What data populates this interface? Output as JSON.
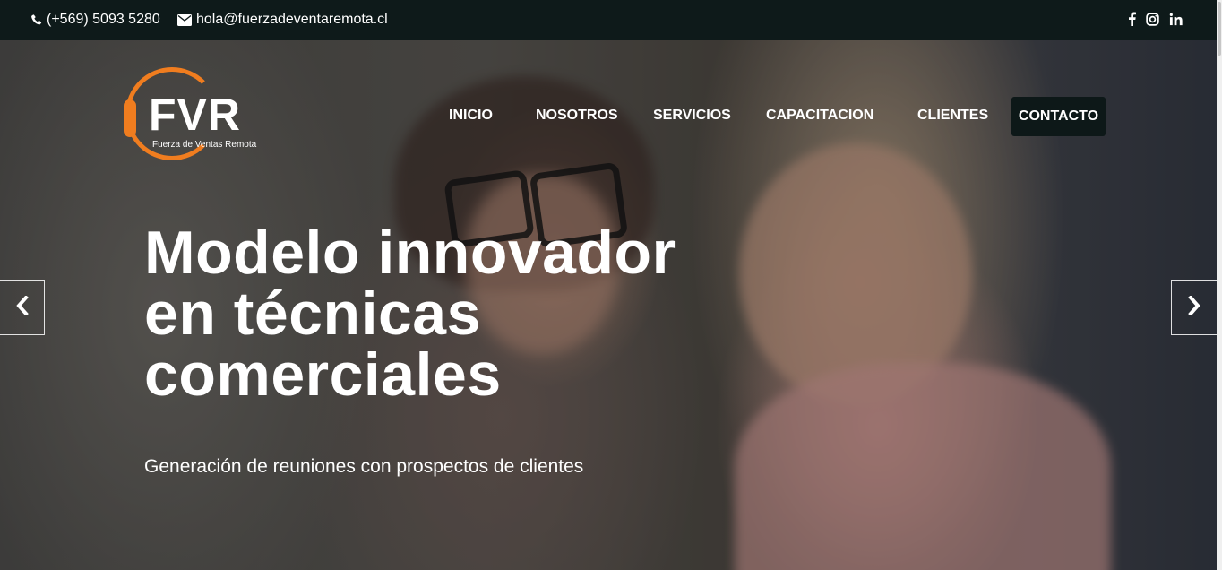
{
  "topbar": {
    "phone": "(+569) 5093 5280",
    "email": "hola@fuerzadeventaremota.cl",
    "social": [
      {
        "icon": "facebook-icon",
        "glyph": "f"
      },
      {
        "icon": "instagram-icon",
        "glyph": ""
      },
      {
        "icon": "linkedin-icon",
        "glyph": "in"
      }
    ]
  },
  "logo": {
    "text": "FVR",
    "subtitle": "Fuerza de Ventas Remota"
  },
  "nav": {
    "items": [
      "INICIO",
      "NOSOTROS",
      "SERVICIOS",
      "CAPACITACION",
      "CLIENTES"
    ],
    "cta": "CONTACTO"
  },
  "hero": {
    "headline": [
      "Modelo innovador",
      "en técnicas",
      "comerciales"
    ],
    "subline": "Generación de reuniones con prospectos de clientes"
  },
  "colors": {
    "topbar_bg": "#0e1a1a",
    "brand_orange": "#f07d1f",
    "cta_bg": "#0d1818"
  }
}
